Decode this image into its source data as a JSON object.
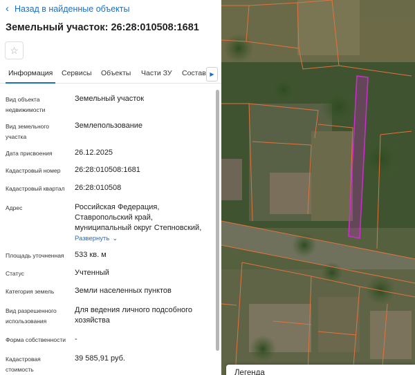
{
  "header": {
    "back_label": "Назад в найденные объекты",
    "title": "Земельный участок: 26:28:010508:1681"
  },
  "tabs": [
    {
      "label": "Информация",
      "active": true
    },
    {
      "label": "Сервисы",
      "active": false
    },
    {
      "label": "Объекты",
      "active": false
    },
    {
      "label": "Части ЗУ",
      "active": false
    },
    {
      "label": "Состав",
      "active": false
    }
  ],
  "fields": {
    "object_type": {
      "label1": "Вид объекта",
      "label2": "недвижимости",
      "value": "Земельный участок"
    },
    "parcel_type": {
      "label1": "Вид земельного",
      "label2": "участка",
      "value": "Землепользование"
    },
    "assign_date": {
      "label": "Дата присвоения",
      "value": "26.12.2025"
    },
    "cadastral_number": {
      "label": "Кадастровый номер",
      "value": "26:28:010508:1681"
    },
    "cadastral_quarter": {
      "label": "Кадастровый квартал",
      "value": "26:28:010508"
    },
    "address": {
      "label": "Адрес",
      "line1": "Российская Федерация,",
      "line2": "Ставропольский край,",
      "line3": "муниципальный округ Степновский,",
      "expand_label": "Развернуть"
    },
    "area": {
      "label": "Площадь уточненная",
      "value": "533 кв. м"
    },
    "status": {
      "label": "Статус",
      "value": "Учтенный"
    },
    "land_category": {
      "label": "Категория земель",
      "value": "Земли населенных пунктов"
    },
    "permitted_use": {
      "label1": "Вид разрешенного",
      "label2": "использования",
      "line1": "Для ведения личного подсобного",
      "line2": "хозяйства"
    },
    "ownership": {
      "label": "Форма собственности",
      "value": "-"
    },
    "cadastral_value": {
      "label1": "Кадастровая",
      "label2": "стоимость",
      "value": "39 585,91 руб."
    }
  },
  "legend": {
    "label": "Легенда"
  },
  "icons": {
    "back": "arrow-left-icon",
    "star": "star-outline-icon",
    "tabs_next": "triangle-right-icon",
    "expand": "chevron-down-icon"
  },
  "colors": {
    "accent": "#1a6fc9",
    "parcel_boundary": "#e2743c",
    "selected_parcel": "#d22bd2"
  }
}
